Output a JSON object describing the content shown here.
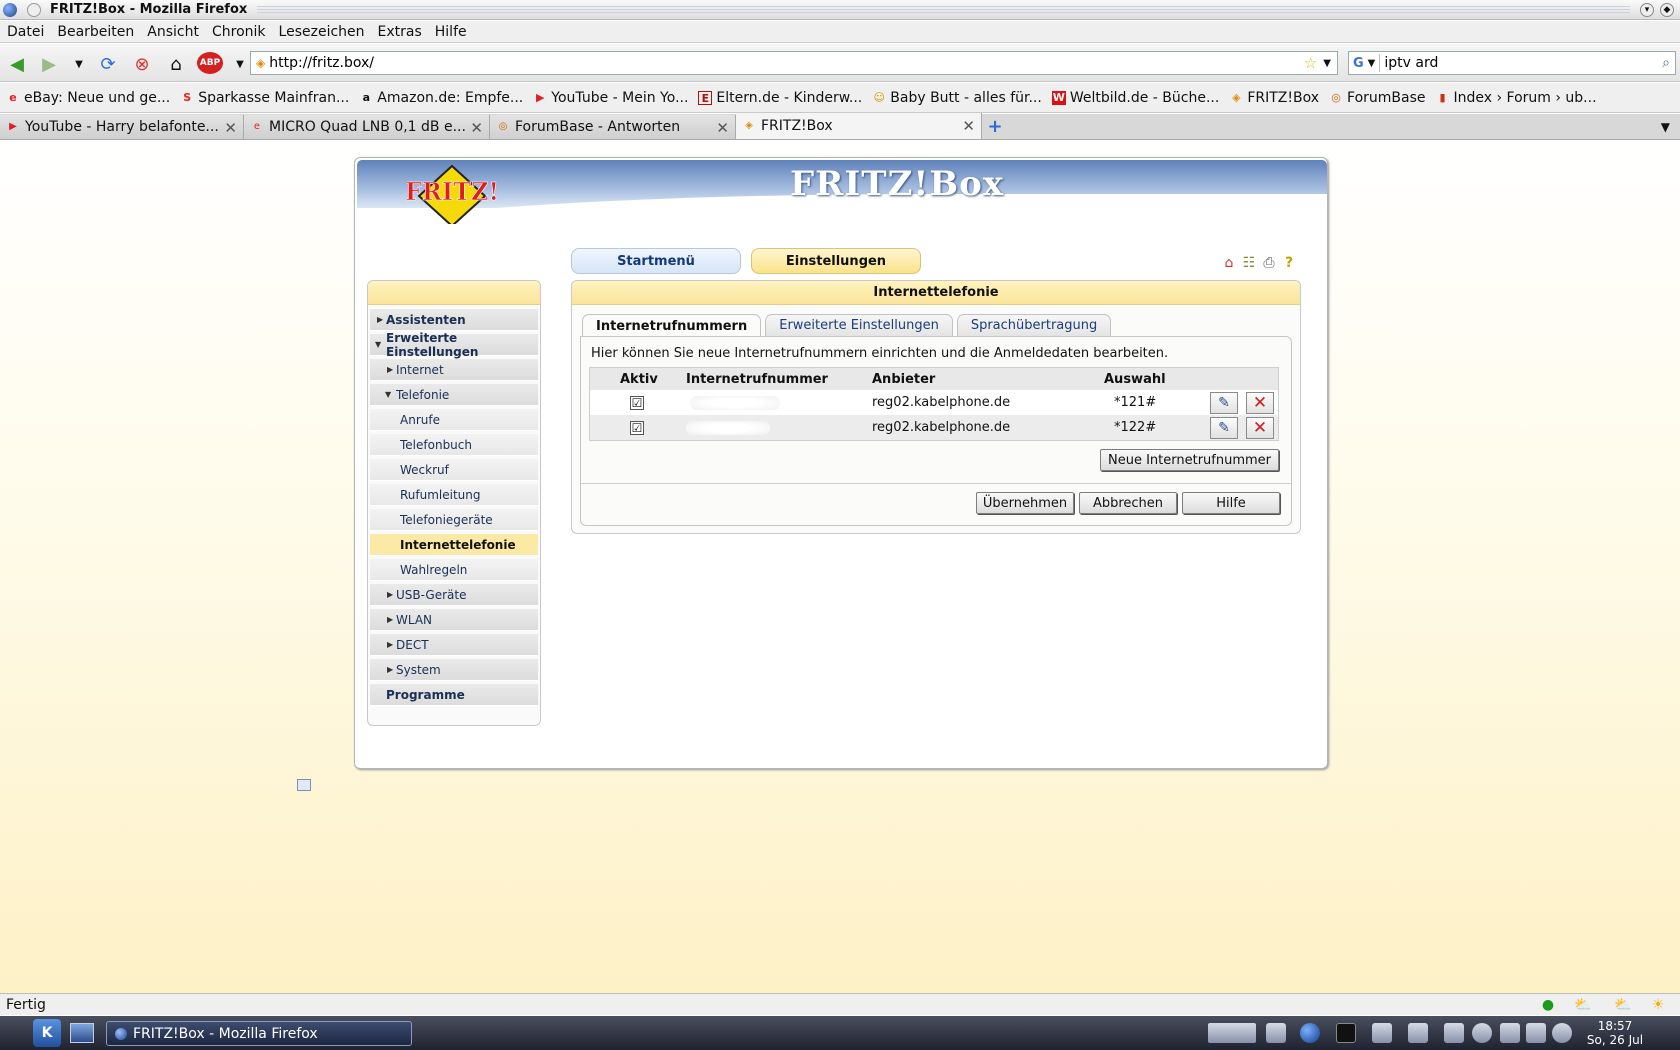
{
  "window": {
    "title": "FRITZ!Box - Mozilla Firefox"
  },
  "menu": [
    "Datei",
    "Bearbeiten",
    "Ansicht",
    "Chronik",
    "Lesezeichen",
    "Extras",
    "Hilfe"
  ],
  "nav": {
    "url": "http://fritz.box/",
    "search": "iptv ard"
  },
  "bookmarks": [
    {
      "label": "eBay: Neue und ge...",
      "icon": "ebay-icon"
    },
    {
      "label": "Sparkasse Mainfran...",
      "icon": "sparkasse-icon"
    },
    {
      "label": "Amazon.de: Empfe...",
      "icon": "amazon-icon"
    },
    {
      "label": "YouTube - Mein Yo...",
      "icon": "youtube-icon"
    },
    {
      "label": "Eltern.de - Kinderw...",
      "icon": "eltern-icon"
    },
    {
      "label": "Baby Butt - alles für...",
      "icon": "baby-icon"
    },
    {
      "label": "Weltbild.de - Büche...",
      "icon": "weltbild-icon"
    },
    {
      "label": "FRITZ!Box",
      "icon": "fritz-icon"
    },
    {
      "label": "ForumBase",
      "icon": "forumbase-icon"
    },
    {
      "label": "Index › Forum › ub...",
      "icon": "forum-icon"
    }
  ],
  "tabs": [
    {
      "label": "YouTube - Harry belafonte...",
      "icon": "youtube-icon"
    },
    {
      "label": "MICRO Quad LNB 0,1 dB e...",
      "icon": "ebay-icon"
    },
    {
      "label": "ForumBase - Antworten",
      "icon": "forumbase-icon"
    },
    {
      "label": "FRITZ!Box",
      "icon": "fritz-icon"
    }
  ],
  "fritz": {
    "logo": "FRITZ!",
    "title": "FRITZ!Box",
    "topnav": {
      "start": "Startmenü",
      "settings": "Einstellungen"
    },
    "sidebar": [
      {
        "label": "Assistenten"
      },
      {
        "label": "Erweiterte Einstellungen"
      },
      {
        "label": "Internet"
      },
      {
        "label": "Telefonie"
      },
      {
        "label": "Anrufe"
      },
      {
        "label": "Telefonbuch"
      },
      {
        "label": "Weckruf"
      },
      {
        "label": "Rufumleitung"
      },
      {
        "label": "Telefoniegeräte"
      },
      {
        "label": "Internettelefonie"
      },
      {
        "label": "Wahlregeln"
      },
      {
        "label": "USB-Geräte"
      },
      {
        "label": "WLAN"
      },
      {
        "label": "DECT"
      },
      {
        "label": "System"
      },
      {
        "label": "Programme"
      }
    ],
    "panel_title": "Internettelefonie",
    "subtabs": [
      "Internetrufnummern",
      "Erweiterte Einstellungen",
      "Sprachübertragung"
    ],
    "intro": "Hier können Sie neue Internetrufnummern einrichten und die Anmeldedaten bearbeiten.",
    "table": {
      "headers": [
        "Aktiv",
        "Internetrufnummer",
        "Anbieter",
        "Auswahl"
      ],
      "rows": [
        {
          "aktiv": "☑",
          "provider": "reg02.kabelphone.de",
          "auswahl": "*121#"
        },
        {
          "aktiv": "☑",
          "provider": "reg02.kabelphone.de",
          "auswahl": "*122#"
        }
      ]
    },
    "buttons": {
      "new": "Neue Internetrufnummer",
      "apply": "Übernehmen",
      "cancel": "Abbrechen",
      "help": "Hilfe"
    }
  },
  "status": {
    "text": "Fertig"
  },
  "taskbar": {
    "item": "FRITZ!Box - Mozilla Firefox",
    "time": "18:57",
    "date": "So, 26 Jul"
  }
}
